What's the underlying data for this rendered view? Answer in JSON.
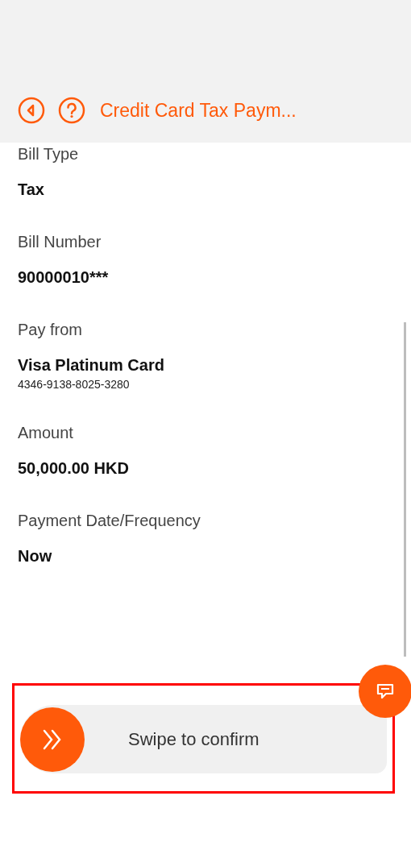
{
  "header": {
    "title": "Credit Card Tax Paym..."
  },
  "fields": [
    {
      "label": "Bill Type",
      "value": "Tax"
    },
    {
      "label": "Bill Number",
      "value": "90000010***"
    },
    {
      "label": "Pay from",
      "value": "Visa Platinum Card",
      "detail": "4346-9138-8025-3280"
    },
    {
      "label": "Amount",
      "value": "50,000.00 HKD"
    },
    {
      "label": "Payment Date/Frequency",
      "value": "Now"
    }
  ],
  "swipe": {
    "label": "Swipe to confirm"
  }
}
